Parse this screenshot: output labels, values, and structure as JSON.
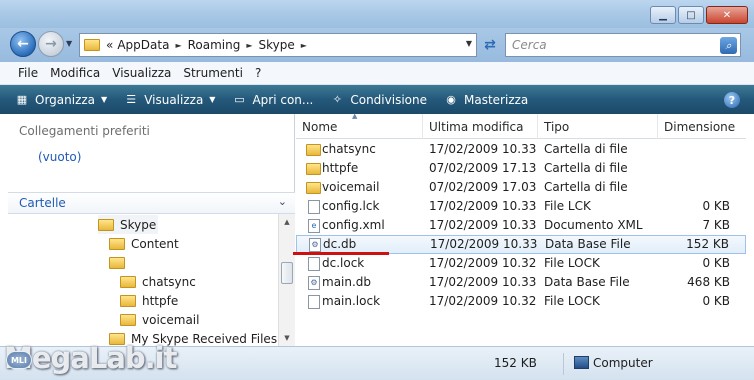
{
  "window": {
    "minimize": "▁",
    "maximize": "□",
    "close": "✕"
  },
  "address": {
    "overflow": "«",
    "crumbs": [
      "AppData",
      "Roaming",
      "Skype"
    ],
    "search_placeholder": "Cerca"
  },
  "menu": [
    "File",
    "Modifica",
    "Visualizza",
    "Strumenti",
    "?"
  ],
  "toolbar": {
    "organize": "Organizza",
    "view": "Visualizza",
    "open": "Apri con...",
    "share": "Condivisione",
    "burn": "Masterizza",
    "help": "?"
  },
  "navpane": {
    "favorites_title": "Collegamenti preferiti",
    "favorites_empty": "(vuoto)",
    "folders_title": "Cartelle",
    "tree": [
      {
        "label": "Skype"
      },
      {
        "label": "Content"
      },
      {
        "label": ""
      },
      {
        "label": "chatsync"
      },
      {
        "label": "httpfe"
      },
      {
        "label": "voicemail"
      },
      {
        "label": "My Skype Received Files"
      }
    ]
  },
  "filelist": {
    "columns": [
      "Nome",
      "Ultima modifica",
      "Tipo",
      "Dimensione"
    ],
    "rows": [
      {
        "name": "chatsync",
        "date": "17/02/2009 10.33",
        "type": "Cartella di file",
        "size": "",
        "icon": "folder"
      },
      {
        "name": "httpfe",
        "date": "07/02/2009 17.13",
        "type": "Cartella di file",
        "size": "",
        "icon": "folder"
      },
      {
        "name": "voicemail",
        "date": "07/02/2009 17.03",
        "type": "Cartella di file",
        "size": "",
        "icon": "folder"
      },
      {
        "name": "config.lck",
        "date": "17/02/2009 10.33",
        "type": "File LCK",
        "size": "0 KB",
        "icon": "file"
      },
      {
        "name": "config.xml",
        "date": "17/02/2009 10.33",
        "type": "Documento XML",
        "size": "7 KB",
        "icon": "xml"
      },
      {
        "name": "dc.db",
        "date": "17/02/2009 10.33",
        "type": "Data Base File",
        "size": "152 KB",
        "icon": "db"
      },
      {
        "name": "dc.lock",
        "date": "17/02/2009 10.32",
        "type": "File LOCK",
        "size": "0 KB",
        "icon": "file"
      },
      {
        "name": "main.db",
        "date": "17/02/2009 10.33",
        "type": "Data Base File",
        "size": "468 KB",
        "icon": "db"
      },
      {
        "name": "main.lock",
        "date": "17/02/2009 10.32",
        "type": "File LOCK",
        "size": "0 KB",
        "icon": "file"
      }
    ]
  },
  "status": {
    "size": "152 KB",
    "location": "Computer",
    "watermark": "MegaLab.it",
    "badge": "MLI"
  },
  "colors": {
    "toolbar": "#24587a",
    "link": "#1f5bb5",
    "annotation": "#d01010"
  }
}
